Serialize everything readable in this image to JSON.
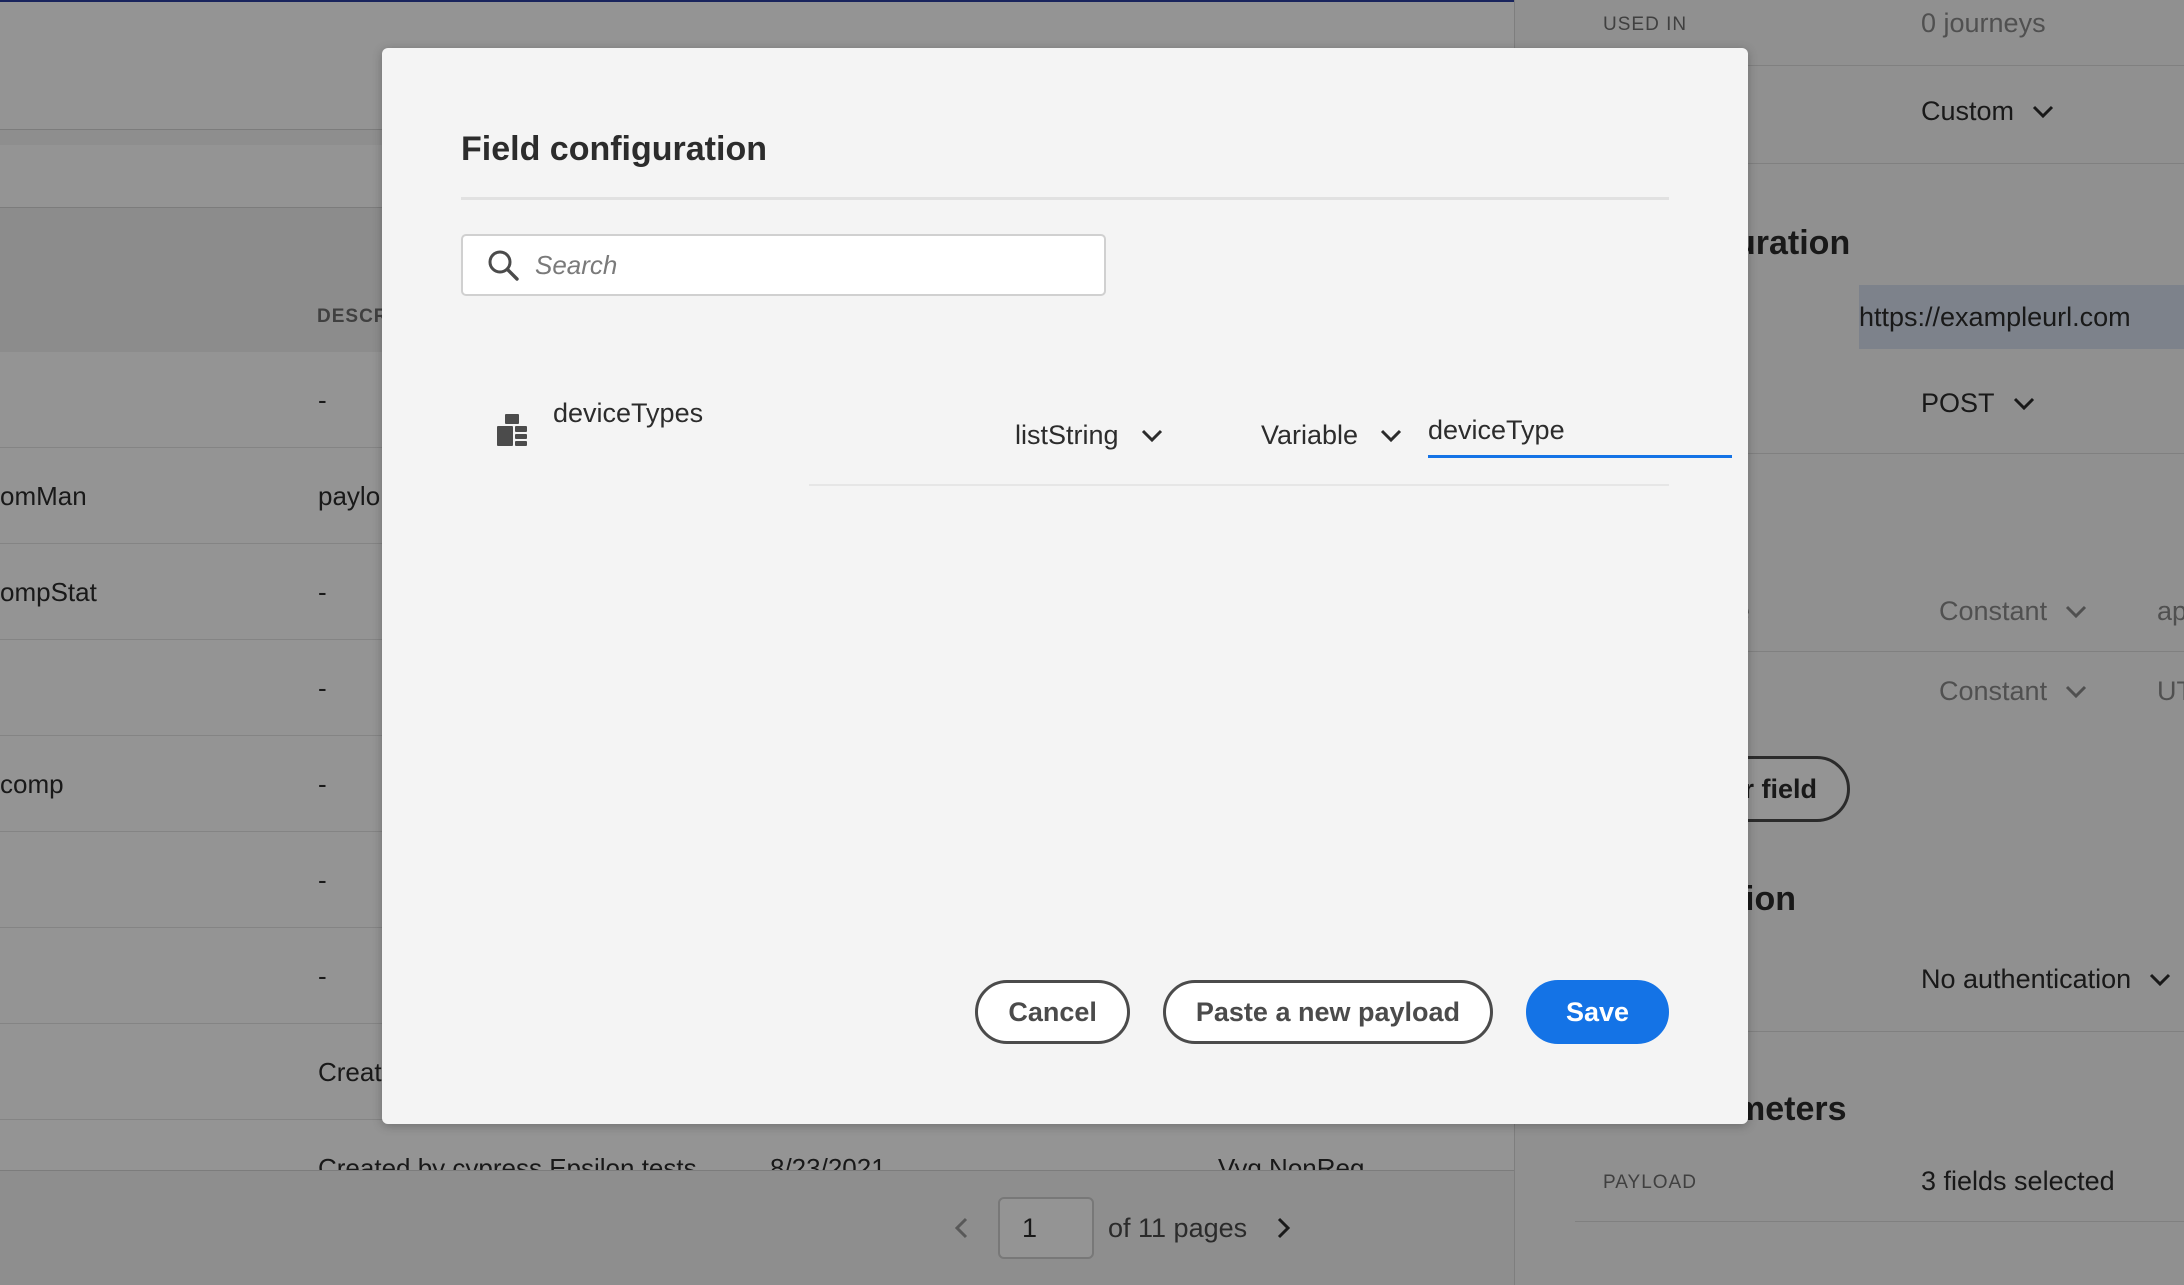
{
  "background": {
    "table": {
      "header_partial": "DESCR",
      "rows": [
        {
          "name": "",
          "description": "-",
          "date": "",
          "owner": ""
        },
        {
          "name": "omMan",
          "description": "paylo",
          "date": "",
          "owner": ""
        },
        {
          "name": "ompStat",
          "description": "-",
          "date": "",
          "owner": ""
        },
        {
          "name": "",
          "description": "-",
          "date": "",
          "owner": ""
        },
        {
          "name": "comp",
          "description": "-",
          "date": "",
          "owner": ""
        },
        {
          "name": "",
          "description": "-",
          "date": "",
          "owner": ""
        },
        {
          "name": "",
          "description": "-",
          "date": "",
          "owner": ""
        },
        {
          "name": "",
          "description": "Creat",
          "date": "",
          "owner": ""
        },
        {
          "name": "",
          "description": "Created by cypress Epsilon tests",
          "date": "8/23/2021",
          "owner": "Vyg NonReg"
        }
      ]
    },
    "pagination": {
      "current_page": "1",
      "total_label": "of 11 pages"
    },
    "panel": {
      "used_in_label": "USED IN",
      "used_in_value": "0 journeys",
      "type_value": "Custom",
      "configuration_title_partial": "uration",
      "url_value": "https://exampleurl.com",
      "method_value": "POST",
      "header_row1_key_partial": "e",
      "header_row1_mode": "Constant",
      "header_row1_value_partial": "app",
      "header_row2_mode": "Constant",
      "header_row2_value_partial": "UTF",
      "add_field_partial": "r field",
      "auth_title_partial": "ion",
      "auth_value": "No authentication",
      "params_title_partial": "meters",
      "payload_label": "PAYLOAD",
      "payload_value": "3 fields selected"
    }
  },
  "modal": {
    "title": "Field configuration",
    "search_placeholder": "Search",
    "fields": [
      {
        "name": "deviceTypes",
        "type": "listString",
        "mode": "Variable",
        "variable_name": "deviceType"
      }
    ],
    "buttons": {
      "cancel": "Cancel",
      "paste": "Paste a new payload",
      "save": "Save"
    },
    "colors": {
      "accent": "#1473e6",
      "overlay": "rgba(0,0,0,0.42)"
    }
  }
}
